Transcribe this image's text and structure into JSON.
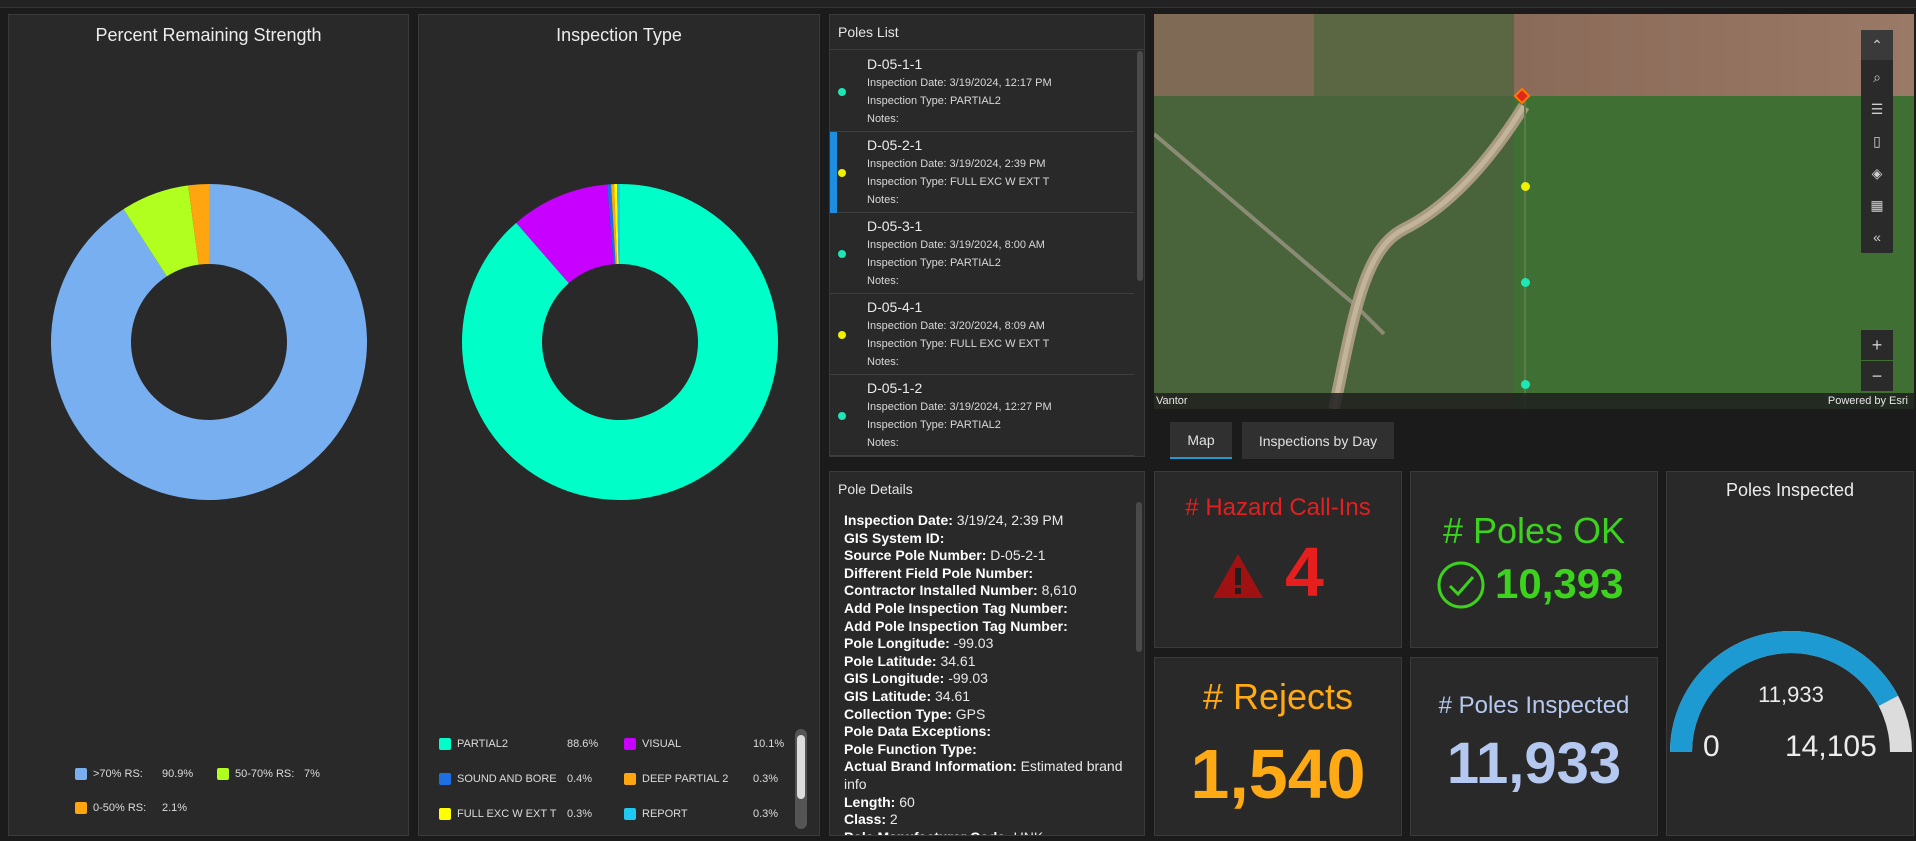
{
  "strength": {
    "title": "Percent Remaining Strength",
    "legend": [
      {
        "label": ">70% RS:",
        "value": "90.9%",
        "color": "#78aff0"
      },
      {
        "label": "50-70% RS:",
        "value": "7%",
        "color": "#b0ff1e"
      },
      {
        "label": "0-50% RS:",
        "value": "2.1%",
        "color": "#ffa510"
      }
    ]
  },
  "inspection_type": {
    "title": "Inspection Type",
    "legend": [
      {
        "label": "PARTIAL2",
        "value": "88.6%",
        "color": "#00ffc8"
      },
      {
        "label": "VISUAL",
        "value": "10.1%",
        "color": "#c800ff"
      },
      {
        "label": "SOUND AND BORE",
        "value": "0.4%",
        "color": "#1e6ee6"
      },
      {
        "label": "DEEP PARTIAL 2",
        "value": "0.3%",
        "color": "#ffa510"
      },
      {
        "label": "FULL EXC W EXT T",
        "value": "0.3%",
        "color": "#ffff00"
      },
      {
        "label": "REPORT",
        "value": "0.3%",
        "color": "#1ec8f0"
      }
    ]
  },
  "chart_data": [
    {
      "type": "pie",
      "title": "Percent Remaining Strength",
      "categories": [
        ">70% RS",
        "50-70% RS",
        "0-50% RS"
      ],
      "values": [
        90.9,
        7.0,
        2.1
      ],
      "colors": [
        "#78aff0",
        "#b0ff1e",
        "#ffa510"
      ]
    },
    {
      "type": "pie",
      "title": "Inspection Type",
      "categories": [
        "PARTIAL2",
        "VISUAL",
        "SOUND AND BORE",
        "DEEP PARTIAL 2",
        "FULL EXC W EXT T",
        "REPORT"
      ],
      "values": [
        88.6,
        10.1,
        0.4,
        0.3,
        0.3,
        0.3
      ],
      "colors": [
        "#00ffc8",
        "#c800ff",
        "#1e6ee6",
        "#ffa510",
        "#ffff00",
        "#1ec8f0"
      ]
    }
  ],
  "poles_list": {
    "title": "Poles List",
    "items": [
      {
        "id": "D-05-1-1",
        "date": "Inspection Date: 3/19/2024, 12:17 PM",
        "type": "Inspection Type: PARTIAL2",
        "notes": "Notes:",
        "dot": "#1ee6b4"
      },
      {
        "id": "D-05-2-1",
        "date": "Inspection Date: 3/19/2024, 2:39 PM",
        "type": "Inspection Type: FULL EXC W EXT T",
        "notes": "Notes:",
        "dot": "#f0f000"
      },
      {
        "id": "D-05-3-1",
        "date": "Inspection Date: 3/19/2024, 8:00 AM",
        "type": "Inspection Type: PARTIAL2",
        "notes": "Notes:",
        "dot": "#1ee6b4"
      },
      {
        "id": "D-05-4-1",
        "date": "Inspection Date: 3/20/2024, 8:09 AM",
        "type": "Inspection Type: FULL EXC W EXT T",
        "notes": "Notes:",
        "dot": "#f0f000"
      },
      {
        "id": "D-05-1-2",
        "date": "Inspection Date: 3/19/2024, 12:27 PM",
        "type": "Inspection Type: PARTIAL2",
        "notes": "Notes:",
        "dot": "#1ee6b4"
      }
    ]
  },
  "pole_details": {
    "title": "Pole Details",
    "fields": [
      {
        "label": "Inspection Date:",
        "value": "3/19/24, 2:39 PM"
      },
      {
        "label": "GIS System ID:",
        "value": ""
      },
      {
        "label": "Source Pole Number:",
        "value": "D-05-2-1"
      },
      {
        "label": "Different Field Pole Number:",
        "value": ""
      },
      {
        "label": "Contractor Installed Number:",
        "value": "8,610"
      },
      {
        "label": "Add Pole Inspection Tag Number:",
        "value": ""
      },
      {
        "label": "Add Pole Inspection Tag Number:",
        "value": ""
      },
      {
        "label": "Pole Longitude:",
        "value": "-99.03"
      },
      {
        "label": "Pole Latitude:",
        "value": "34.61"
      },
      {
        "label": "GIS Longitude:",
        "value": "-99.03"
      },
      {
        "label": "GIS Latitude:",
        "value": "34.61"
      },
      {
        "label": "Collection Type:",
        "value": "GPS"
      },
      {
        "label": "Pole Data Exceptions:",
        "value": ""
      },
      {
        "label": "Pole Function Type:",
        "value": ""
      },
      {
        "label": "Actual Brand Information:",
        "value": "Estimated brand"
      },
      {
        "label": "",
        "value": "info"
      },
      {
        "label": "Length:",
        "value": "60"
      },
      {
        "label": "Class:",
        "value": "2"
      },
      {
        "label": "Pole Manufacturer Code:",
        "value": "UNK"
      }
    ]
  },
  "map": {
    "attribution_left": "Vantor",
    "attribution_right": "Powered by Esri",
    "tools": [
      "collapse-icon",
      "search-icon",
      "legend-icon",
      "bookmark-icon",
      "layers-icon",
      "qr-icon",
      "expand-left-icon"
    ],
    "zoom_in": "+",
    "zoom_out": "−"
  },
  "tabs": [
    {
      "label": "Map",
      "active": true
    },
    {
      "label": "Inspections by Day",
      "active": false
    }
  ],
  "kpis": {
    "hazard": {
      "title": "# Hazard Call-Ins",
      "value": "4",
      "color": "#e61e1e"
    },
    "poles_ok": {
      "title": "# Poles OK",
      "value": "10,393",
      "color": "#3cd21e"
    },
    "rejects": {
      "title": "# Rejects",
      "value": "1,540",
      "color": "#ffaa14"
    },
    "poles_inspected": {
      "title": "# Poles Inspected",
      "value": "11,933",
      "color": "#b4c8f0"
    }
  },
  "gauge": {
    "title": "Poles Inspected",
    "value": "11,933",
    "min": "0",
    "max": "14,105",
    "fraction": 0.846,
    "color": "#1e9ad2"
  }
}
